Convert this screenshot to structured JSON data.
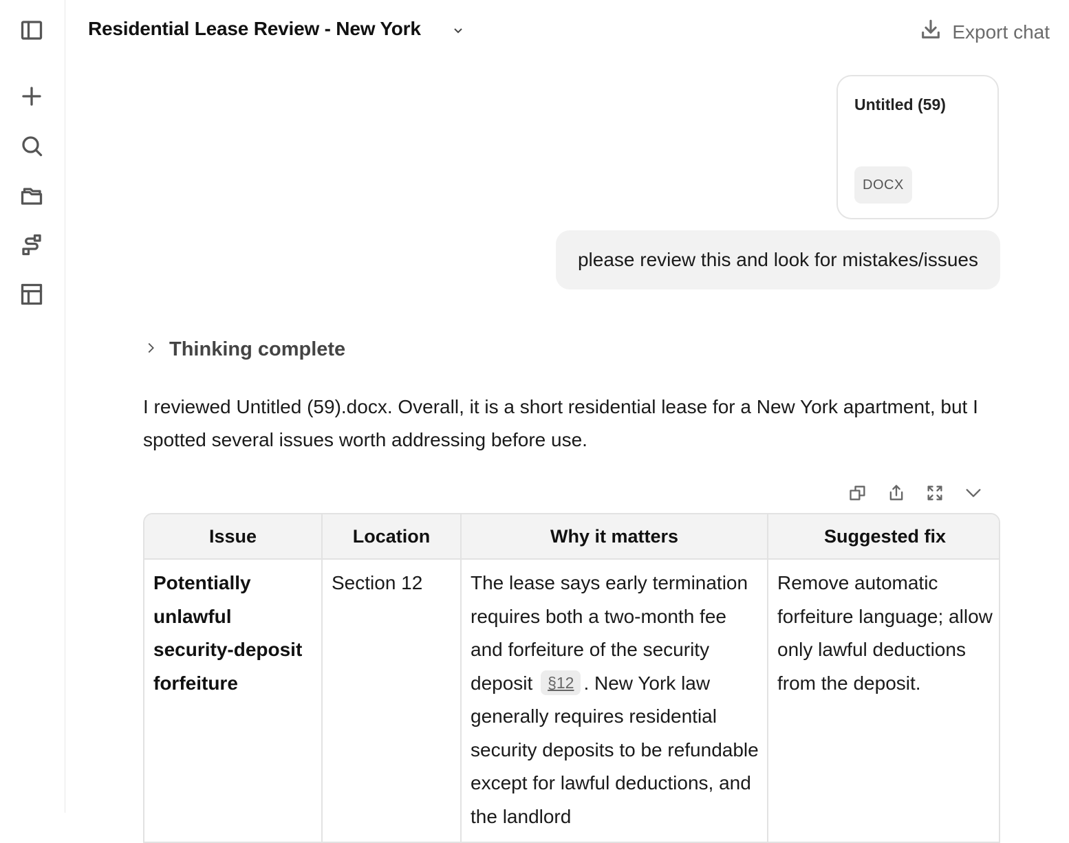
{
  "header": {
    "title": "Residential Lease Review - New York",
    "export_label": "Export chat"
  },
  "sidebar": {
    "items": [
      {
        "icon": "sidebar-toggle-icon"
      },
      {
        "icon": "plus-icon"
      },
      {
        "icon": "search-icon"
      },
      {
        "icon": "folders-icon"
      },
      {
        "icon": "workflow-icon"
      },
      {
        "icon": "table-icon"
      }
    ]
  },
  "attachment": {
    "name": "Untitled (59)",
    "type": "DOCX"
  },
  "user_message": "please review this and look for mistakes/issues",
  "thinking": {
    "label": "Thinking complete"
  },
  "assistant": {
    "intro": "I reviewed Untitled (59).docx. Overall, it is a short residential lease for a New York apartment, but I spotted several issues worth addressing before use."
  },
  "table": {
    "columns": [
      "Issue",
      "Location",
      "Why it matters",
      "Suggested fix"
    ],
    "rows": [
      {
        "issue": "Potentially unlawful security-deposit forfeiture",
        "location": "Section 12",
        "why_before": "The lease says early termination requires both a two-month fee and forfeiture of the security deposit",
        "citation": "§12",
        "why_after": ". New York law generally requires residential security deposits to be refundable except for lawful deductions, and the landlord",
        "fix": "Remove automatic forfeiture language; allow only lawful deductions from the deposit."
      }
    ]
  }
}
